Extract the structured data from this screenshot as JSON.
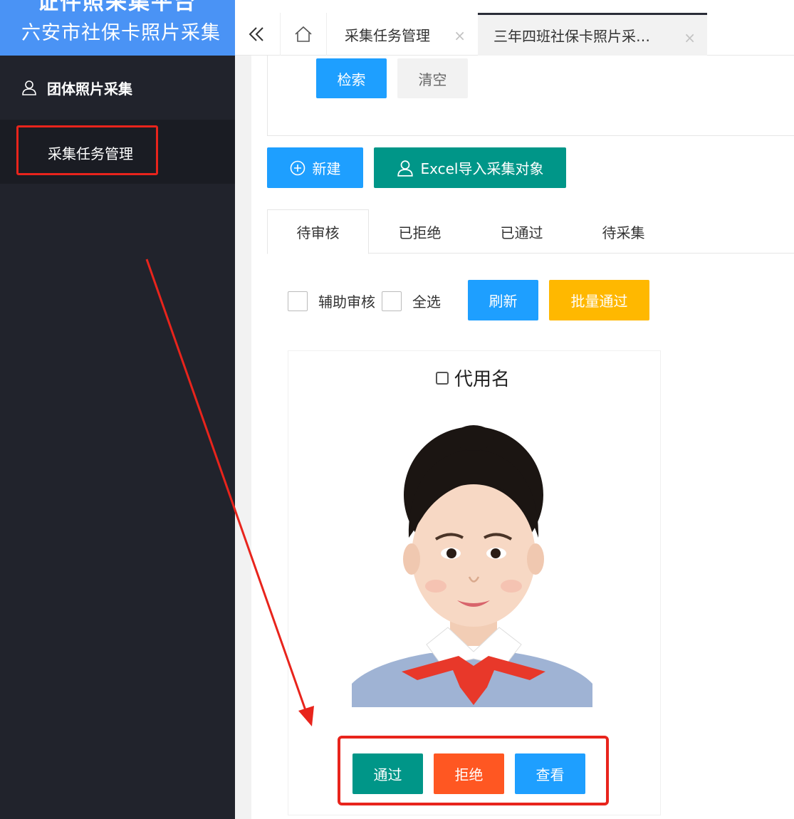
{
  "sidebar": {
    "brand_top": "证件照采集平台",
    "brand_sub": "六安市社保卡照片采集",
    "group_label": "团体照片采集",
    "submenu_label": "采集任务管理"
  },
  "tabbar": {
    "tabs": [
      {
        "label": "采集任务管理",
        "close": "×"
      },
      {
        "label": "三年四班社保卡照片采…",
        "close": "×"
      }
    ]
  },
  "search": {
    "search_label": "检索",
    "clear_label": "清空"
  },
  "toolbar": {
    "new_label": "新建",
    "import_label": "Excel导入采集对象"
  },
  "status_tabs": [
    "待审核",
    "已拒绝",
    "已通过",
    "待采集"
  ],
  "filters": {
    "assist_review_label": "辅助审核",
    "select_all_label": "全选",
    "refresh_label": "刷新",
    "batch_pass_label": "批量通过"
  },
  "card": {
    "name": "代用名",
    "pass_label": "通过",
    "reject_label": "拒绝",
    "view_label": "查看"
  },
  "colors": {
    "brand_blue": "#4a93f5",
    "sidebar_bg": "#21232c",
    "primary": "#1e9fff",
    "teal": "#009688",
    "warning": "#ffb800",
    "danger": "#ff5722",
    "annotation_red": "#e8241c"
  }
}
